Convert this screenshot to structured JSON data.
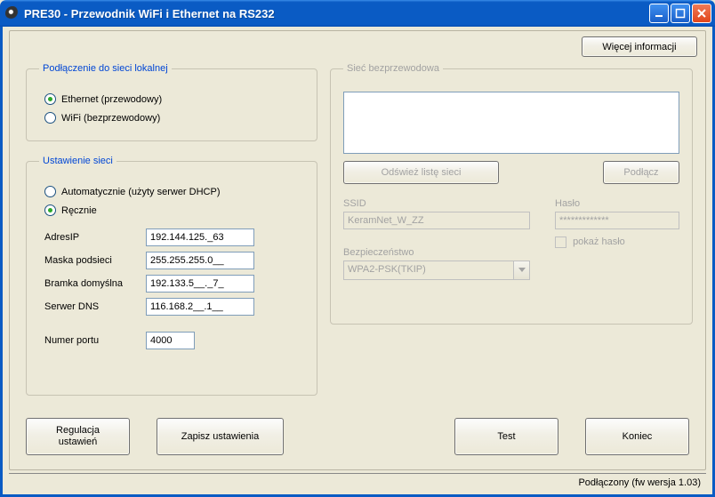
{
  "window": {
    "title": "PRE30 - Przewodnik WiFi i Ethernet na RS232"
  },
  "buttons": {
    "more_info": "Więcej informacji",
    "refresh_networks": "Odśwież listę sieci",
    "connect_wifi": "Podłącz",
    "regulate": "Regulacja ustawień",
    "save": "Zapisz ustawienia",
    "test": "Test",
    "close": "Koniec"
  },
  "groups": {
    "connection": {
      "legend": "Podłączenie do sieci lokalnej",
      "ethernet": "Ethernet (przewodowy)",
      "wifi": "WiFi (bezprzewodowy)"
    },
    "network": {
      "legend": "Ustawienie sieci",
      "auto": "Automatycznie (użyty serwer DHCP)",
      "manual": "Ręcznie",
      "ip_label": "AdresIP",
      "ip_value": "192.144.125._63",
      "mask_label": "Maska podsieci",
      "mask_value": "255.255.255.0__",
      "gateway_label": "Bramka domyślna",
      "gateway_value": "192.133.5__._7_",
      "dns_label": "Serwer DNS",
      "dns_value": "116.168.2__.1__",
      "port_label": "Numer portu",
      "port_value": "4000"
    },
    "wifi": {
      "legend": "Sieć bezprzewodowa",
      "ssid_label": "SSID",
      "ssid_value": "KeramNet_W_ZZ",
      "security_label": "Bezpieczeństwo",
      "security_value": "WPA2-PSK(TKIP)",
      "password_label": "Hasło",
      "password_value": "*************",
      "show_password": "pokaż hasło"
    }
  },
  "status": "Podłączony (fw wersja 1.03)"
}
